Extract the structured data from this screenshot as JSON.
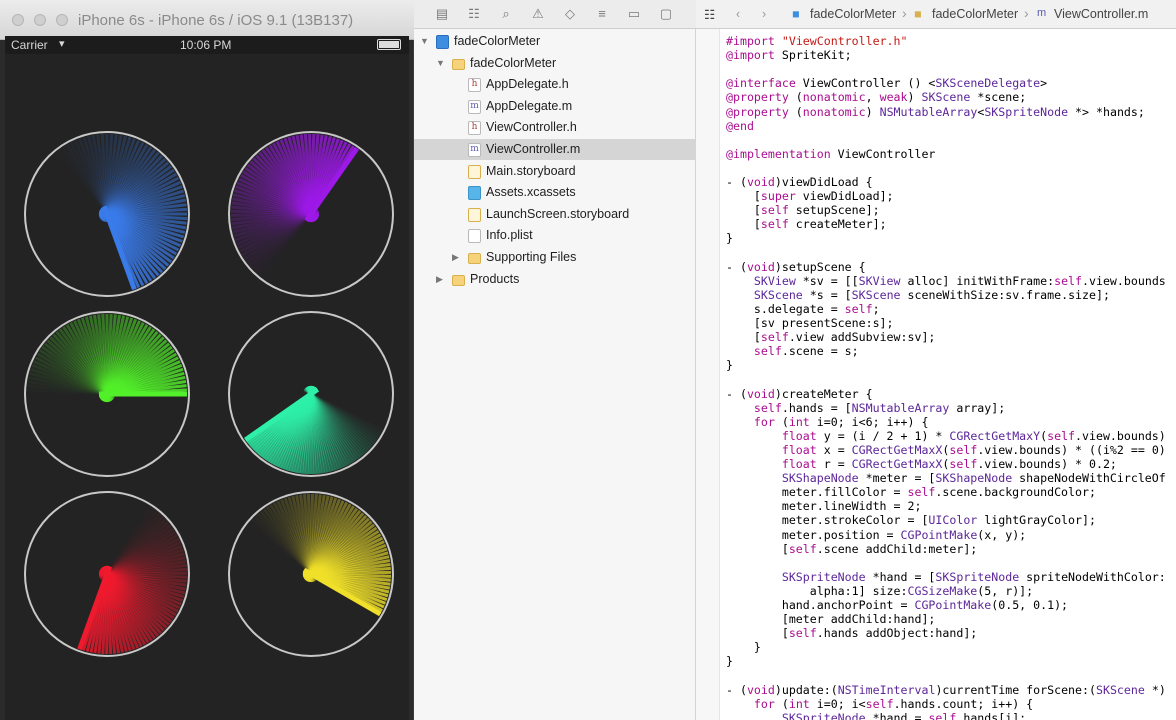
{
  "simulator": {
    "title": "iPhone 6s - iPhone 6s / iOS 9.1 (13B137)",
    "status_bar": {
      "carrier": "Carrier",
      "time": "10:06 PM"
    },
    "meters": [
      {
        "color": "#3a7bea",
        "hand_angle_deg": 160,
        "trail_length_deg": 200
      },
      {
        "color": "#9d19e8",
        "hand_angle_deg": 35,
        "trail_length_deg": 180
      },
      {
        "color": "#52f02a",
        "hand_angle_deg": 90,
        "trail_length_deg": 180
      },
      {
        "color": "#2ef0a8",
        "hand_angle_deg": 235,
        "trail_length_deg": 120
      },
      {
        "color": "#f01a2e",
        "hand_angle_deg": 200,
        "trail_length_deg": 170
      },
      {
        "color": "#f0e02a",
        "hand_angle_deg": 120,
        "trail_length_deg": 170
      }
    ]
  },
  "xcode": {
    "navigator": {
      "items": [
        {
          "label": "fadeColorMeter",
          "icon": "project-icon",
          "kind": "proj",
          "indent": 0,
          "disclosure": "open"
        },
        {
          "label": "fadeColorMeter",
          "icon": "folder-icon",
          "kind": "folder",
          "indent": 1,
          "disclosure": "open"
        },
        {
          "label": "AppDelegate.h",
          "icon": "header-file-icon",
          "kind": "hfile",
          "glyph": "h",
          "indent": 2
        },
        {
          "label": "AppDelegate.m",
          "icon": "implementation-file-icon",
          "kind": "mfile",
          "glyph": "m",
          "indent": 2
        },
        {
          "label": "ViewController.h",
          "icon": "header-file-icon",
          "kind": "hfile",
          "glyph": "h",
          "indent": 2
        },
        {
          "label": "ViewController.m",
          "icon": "implementation-file-icon",
          "kind": "mfile",
          "glyph": "m",
          "indent": 2,
          "selected": true
        },
        {
          "label": "Main.storyboard",
          "icon": "storyboard-icon",
          "kind": "sb",
          "indent": 2
        },
        {
          "label": "Assets.xcassets",
          "icon": "assets-icon",
          "kind": "assets",
          "indent": 2
        },
        {
          "label": "LaunchScreen.storyboard",
          "icon": "storyboard-icon",
          "kind": "sb",
          "indent": 2
        },
        {
          "label": "Info.plist",
          "icon": "plist-icon",
          "kind": "plist",
          "indent": 2
        },
        {
          "label": "Supporting Files",
          "icon": "folder-icon",
          "kind": "folder",
          "indent": 2,
          "disclosure": "closed"
        },
        {
          "label": "Products",
          "icon": "folder-icon",
          "kind": "folder",
          "indent": 1,
          "disclosure": "closed"
        }
      ]
    },
    "jump_bar": {
      "items": [
        "fadeColorMeter",
        "fadeColorMeter",
        "ViewController.m"
      ]
    },
    "code_lines": [
      "#import \"ViewController.h\"",
      "@import SpriteKit;",
      "",
      "@interface ViewController () <SKSceneDelegate>",
      "@property (nonatomic, weak) SKScene *scene;",
      "@property (nonatomic) NSMutableArray<SKSpriteNode *> *hands;",
      "@end",
      "",
      "@implementation ViewController",
      "",
      "- (void)viewDidLoad {",
      "    [super viewDidLoad];",
      "    [self setupScene];",
      "    [self createMeter];",
      "}",
      "",
      "- (void)setupScene {",
      "    SKView *sv = [[SKView alloc] initWithFrame:self.view.bounds",
      "    SKScene *s = [SKScene sceneWithSize:sv.frame.size];",
      "    s.delegate = self;",
      "    [sv presentScene:s];",
      "    [self.view addSubview:sv];",
      "    self.scene = s;",
      "}",
      "",
      "- (void)createMeter {",
      "    self.hands = [NSMutableArray array];",
      "    for (int i=0; i<6; i++) {",
      "        float y = (i / 2 + 1) * CGRectGetMaxY(self.view.bounds)",
      "        float x = CGRectGetMaxX(self.view.bounds) * ((i%2 == 0)",
      "        float r = CGRectGetMaxX(self.view.bounds) * 0.2;",
      "        SKShapeNode *meter = [SKShapeNode shapeNodeWithCircleOf",
      "        meter.fillColor = self.scene.backgroundColor;",
      "        meter.lineWidth = 2;",
      "        meter.strokeColor = [UIColor lightGrayColor];",
      "        meter.position = CGPointMake(x, y);",
      "        [self.scene addChild:meter];",
      "",
      "        SKSpriteNode *hand = [SKSpriteNode spriteNodeWithColor:",
      "            alpha:1] size:CGSizeMake(5, r)];",
      "        hand.anchorPoint = CGPointMake(0.5, 0.1);",
      "        [meter addChild:hand];",
      "        [self.hands addObject:hand];",
      "    }",
      "}",
      "",
      "- (void)update:(NSTimeInterval)currentTime forScene:(SKScene *)",
      "    for (int i=0; i<self.hands.count; i++) {",
      "        SKSpriteNode *hand = self.hands[i];"
    ]
  }
}
